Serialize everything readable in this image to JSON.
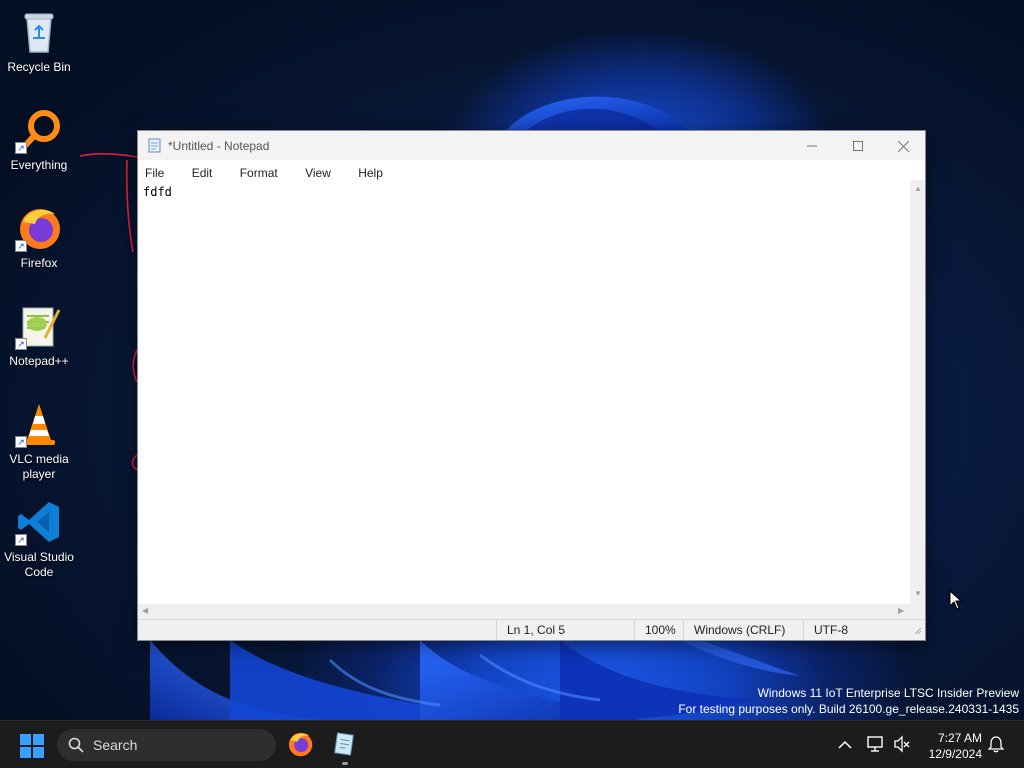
{
  "desktop": {
    "icons": [
      {
        "label": "Recycle Bin"
      },
      {
        "label": "Everything"
      },
      {
        "label": "Firefox"
      },
      {
        "label": "Notepad++"
      },
      {
        "label": "VLC media player"
      },
      {
        "label": "Visual Studio Code"
      }
    ],
    "watermark": {
      "line1": "Windows 11 IoT Enterprise LTSC Insider Preview",
      "line2": "For testing purposes only. Build 26100.ge_release.240331-1435"
    }
  },
  "notepad": {
    "title": "*Untitled - Notepad",
    "menu": {
      "file": "File",
      "edit": "Edit",
      "format": "Format",
      "view": "View",
      "help": "Help"
    },
    "content": "fdfd",
    "status": {
      "position": "Ln 1, Col 5",
      "zoom": "100%",
      "line_ending": "Windows (CRLF)",
      "encoding": "UTF-8"
    }
  },
  "taskbar": {
    "search_label": "Search",
    "time": "7:27 AM",
    "date": "12/9/2024",
    "pinned": [
      "firefox-icon",
      "notepad-icon"
    ]
  },
  "colors": {
    "taskbar_bg": "#1c1c1c",
    "accent": "#1a4fd8",
    "titlebar_bg": "#f3f3f3"
  }
}
